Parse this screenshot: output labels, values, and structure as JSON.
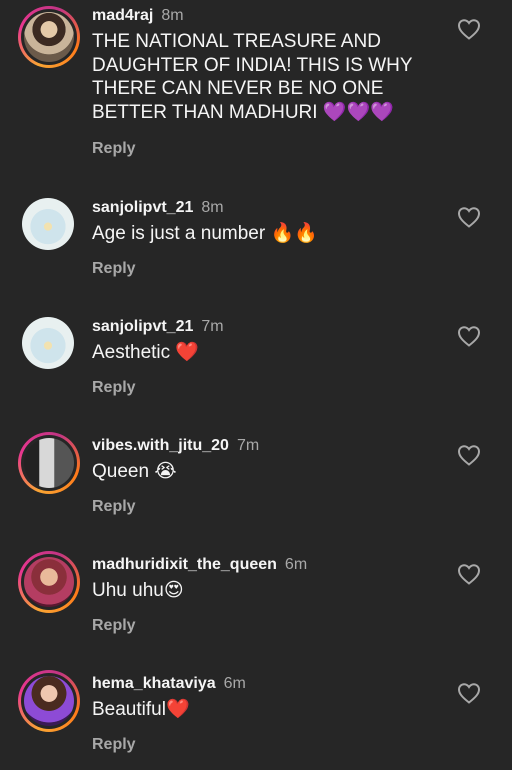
{
  "comments": [
    {
      "username": "mad4raj",
      "time": "8m",
      "text": "THE NATIONAL TREASURE AND DAUGHTER OF INDIA! THIS IS WHY THERE CAN NEVER BE NO ONE BETTER THAN MADHURI 💜💜💜",
      "reply": "Reply"
    },
    {
      "username": "sanjolipvt_21",
      "time": "8m",
      "text": "Age is just a number 🔥🔥",
      "reply": "Reply"
    },
    {
      "username": "sanjolipvt_21",
      "time": "7m",
      "text": "Aesthetic ❤️",
      "reply": "Reply"
    },
    {
      "username": "vibes.with_jitu_20",
      "time": "7m",
      "text": "Queen 😭",
      "reply": "Reply"
    },
    {
      "username": "madhuridixit_the_queen",
      "time": "6m",
      "text": "Uhu uhu😍",
      "reply": "Reply"
    },
    {
      "username": "hema_khataviya",
      "time": "6m",
      "text": "Beautiful❤️",
      "reply": "Reply"
    }
  ],
  "icons": {
    "like": "heart-outline-icon"
  },
  "colors": {
    "background": "#262626",
    "text": "#f5f5f5",
    "muted": "#a8a8a8"
  }
}
